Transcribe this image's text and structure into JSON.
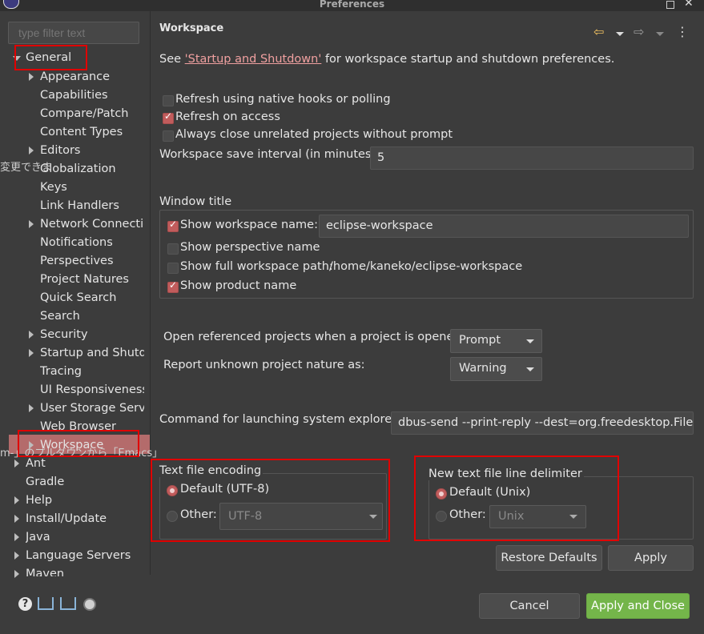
{
  "window": {
    "title": "Preferences"
  },
  "filter": {
    "placeholder": "type filter text"
  },
  "tree": {
    "general": "General",
    "general_children": [
      "Appearance",
      "Capabilities",
      "Compare/Patch",
      "Content Types",
      "Editors",
      "Globalization",
      "Keys",
      "Link Handlers",
      "Network Connectio",
      "Notifications",
      "Perspectives",
      "Project Natures",
      "Quick Search",
      "Search",
      "Security",
      "Startup and Shutd",
      "Tracing",
      "UI Responsiveness",
      "User Storage Servi",
      "Web Browser",
      "Workspace"
    ],
    "top_level": [
      "Ant",
      "Gradle",
      "Help",
      "Install/Update",
      "Java",
      "Language Servers",
      "Maven"
    ]
  },
  "background_text": {
    "left": "変更できま",
    "mid": "m-」のプルダウンから「Emacs」"
  },
  "page": {
    "title": "Workspace",
    "intro_prefix": "See ",
    "intro_link": "'Startup and Shutdown'",
    "intro_suffix": " for workspace startup and shutdown preferences.",
    "refresh_native": "Refresh using native hooks or polling",
    "refresh_access": "Refresh on access",
    "close_unrelated": "Always close unrelated projects without prompt",
    "save_interval_label": "Workspace save interval (in minutes):",
    "save_interval_value": "5",
    "window_title_group": "Window title",
    "show_ws_name": "Show workspace name:",
    "ws_name_value": "eclipse-workspace",
    "show_perspective": "Show perspective name",
    "show_full_path": "Show full workspace path:",
    "full_path_value": "/home/kaneko/eclipse-workspace",
    "show_product": "Show product name",
    "open_ref_label": "Open referenced projects when a project is opened:",
    "open_ref_value": "Prompt",
    "unknown_nature_label": "Report unknown project nature as:",
    "unknown_nature_value": "Warning",
    "explorer_label": "Command for launching system explorer:",
    "explorer_value": "dbus-send --print-reply --dest=org.freedesktop.FileMa",
    "encoding_group": "Text file encoding",
    "encoding_default": "Default (UTF-8)",
    "encoding_other": "Other:",
    "encoding_other_value": "UTF-8",
    "delimiter_group": "New text file line delimiter",
    "delimiter_default": "Default (Unix)",
    "delimiter_other": "Other:",
    "delimiter_other_value": "Unix"
  },
  "buttons": {
    "restore": "Restore Defaults",
    "apply": "Apply",
    "cancel": "Cancel",
    "apply_close": "Apply and Close"
  },
  "checks": {
    "refresh_native": false,
    "refresh_access": true,
    "close_unrelated": false,
    "show_ws_name": true,
    "show_perspective": false,
    "show_full_path": false,
    "show_product": true
  },
  "colors": {
    "accent": "#c15c5c",
    "selection": "#b46b6b",
    "primary_button": "#74b54a",
    "highlight_box": "#e00000"
  }
}
